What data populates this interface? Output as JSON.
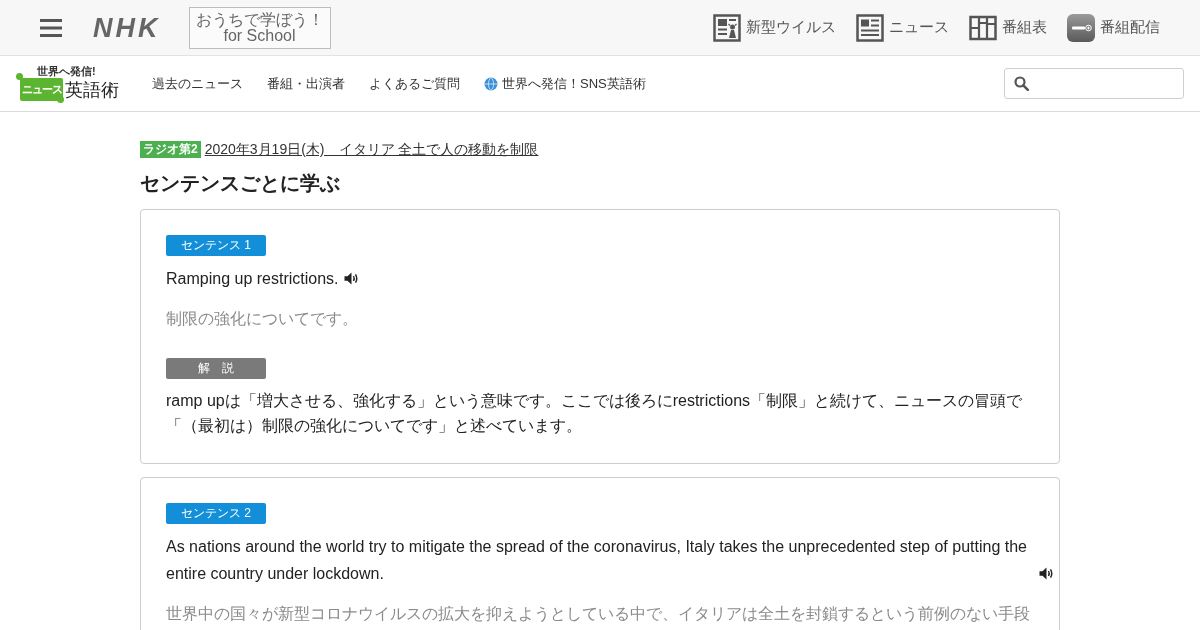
{
  "top_bar": {
    "brand": "NHK",
    "school_button": [
      "おうちで学ぼう！",
      "for School"
    ],
    "links": [
      {
        "kind": "virus",
        "label": "新型ウイルス"
      },
      {
        "kind": "news",
        "label": "ニュース"
      },
      {
        "kind": "schedule",
        "label": "番組表"
      },
      {
        "kind": "stream",
        "label": "番組配信"
      }
    ]
  },
  "site_header": {
    "logo": {
      "tagline": "世界へ発信!",
      "badge": "ニュース",
      "title": "英語術"
    },
    "nav": [
      {
        "kind": "text",
        "label": "過去のニュース"
      },
      {
        "kind": "text",
        "label": "番組・出演者"
      },
      {
        "kind": "text",
        "label": "よくあるご質問"
      },
      {
        "kind": "globe",
        "label": "世界へ発信！SNS英語術"
      }
    ]
  },
  "episode": {
    "badge": "ラジオ第2",
    "link": "2020年3月19日(木)　イタリア 全土で人の移動を制限"
  },
  "heading": "センテンスごとに学ぶ",
  "sentences": [
    {
      "label": "センテンス 1",
      "english": "Ramping up restrictions.",
      "japanese": "制限の強化についてです。",
      "note_label": "解　説",
      "note": "ramp upは「増大させる、強化する」という意味です。ここでは後ろにrestrictions「制限」と続けて、ニュースの冒頭で「（最初は）制限の強化についてです」と述べています。"
    },
    {
      "label": "センテンス 2",
      "english": "As nations around the world try to mitigate the spread of the coronavirus, Italy takes the unprecedented step of putting the entire country under lockdown.",
      "japanese": "世界中の国々が新型コロナウイルスの拡大を抑えようとしている中で、イタリアは全土を封鎖するという前例のない手段"
    }
  ]
}
